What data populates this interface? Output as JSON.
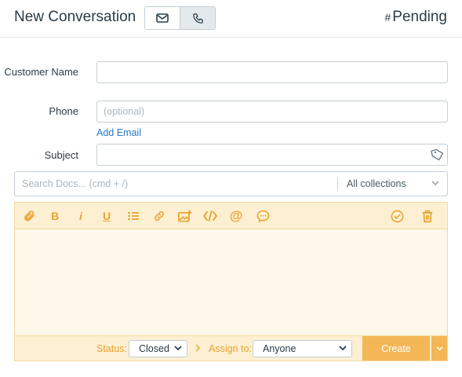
{
  "header": {
    "title": "New Conversation",
    "type_toggle": [
      {
        "icon": "envelope-icon",
        "active": false
      },
      {
        "icon": "phone-icon",
        "active": true
      }
    ],
    "ticket_hash": "#",
    "ticket_status": "Pending"
  },
  "form": {
    "customer_label": "Customer Name",
    "customer_value": "",
    "phone_label": "Phone",
    "phone_placeholder": "(optional)",
    "add_email": "Add Email",
    "subject_label": "Subject",
    "subject_value": ""
  },
  "docs": {
    "placeholder": "Search Docs... (cmd + /)",
    "collections": "All collections"
  },
  "editor": {
    "toolbar": [
      "attachment-icon",
      "bold-icon",
      "italic-icon",
      "underline-icon",
      "list-icon",
      "link-icon",
      "image-add-icon",
      "code-icon",
      "mention-icon",
      "saved-reply-icon",
      "check-circle-icon",
      "trash-icon"
    ],
    "bold_glyph": "B",
    "italic_glyph": "i",
    "underline_glyph": "U",
    "mention_glyph": "@",
    "body": ""
  },
  "footer": {
    "status_label": "Status:",
    "status_value": "Closed",
    "assign_label": "Assign to:",
    "assign_value": "Anyone",
    "create_label": "Create"
  },
  "colors": {
    "accent": "#e9a22f",
    "button": "#f4b656",
    "editor_bg": "#fdf8e9",
    "toolbar_bg": "#fdf0d2",
    "link": "#2878c2"
  }
}
